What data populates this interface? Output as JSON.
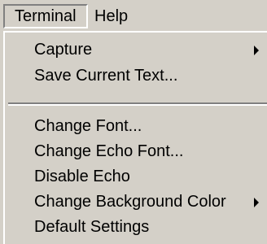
{
  "menubar": {
    "items": [
      {
        "label": "Terminal",
        "active": true
      },
      {
        "label": "Help",
        "active": false
      }
    ]
  },
  "menu": {
    "items": [
      {
        "label": "Capture",
        "submenu": true
      },
      {
        "label": "Save Current Text...",
        "submenu": false
      },
      {
        "label": "Change Font...",
        "submenu": false
      },
      {
        "label": "Change Echo Font...",
        "submenu": false
      },
      {
        "label": "Disable Echo",
        "submenu": false
      },
      {
        "label": "Change Background Color",
        "submenu": true
      },
      {
        "label": "Default Settings",
        "submenu": false
      }
    ]
  },
  "icons": {
    "submenu": "triangle-right-icon"
  },
  "colors": {
    "menu_background": "#d4d0c8",
    "highlight": "#ffffff",
    "shadow": "#808080",
    "text": "#000000"
  }
}
